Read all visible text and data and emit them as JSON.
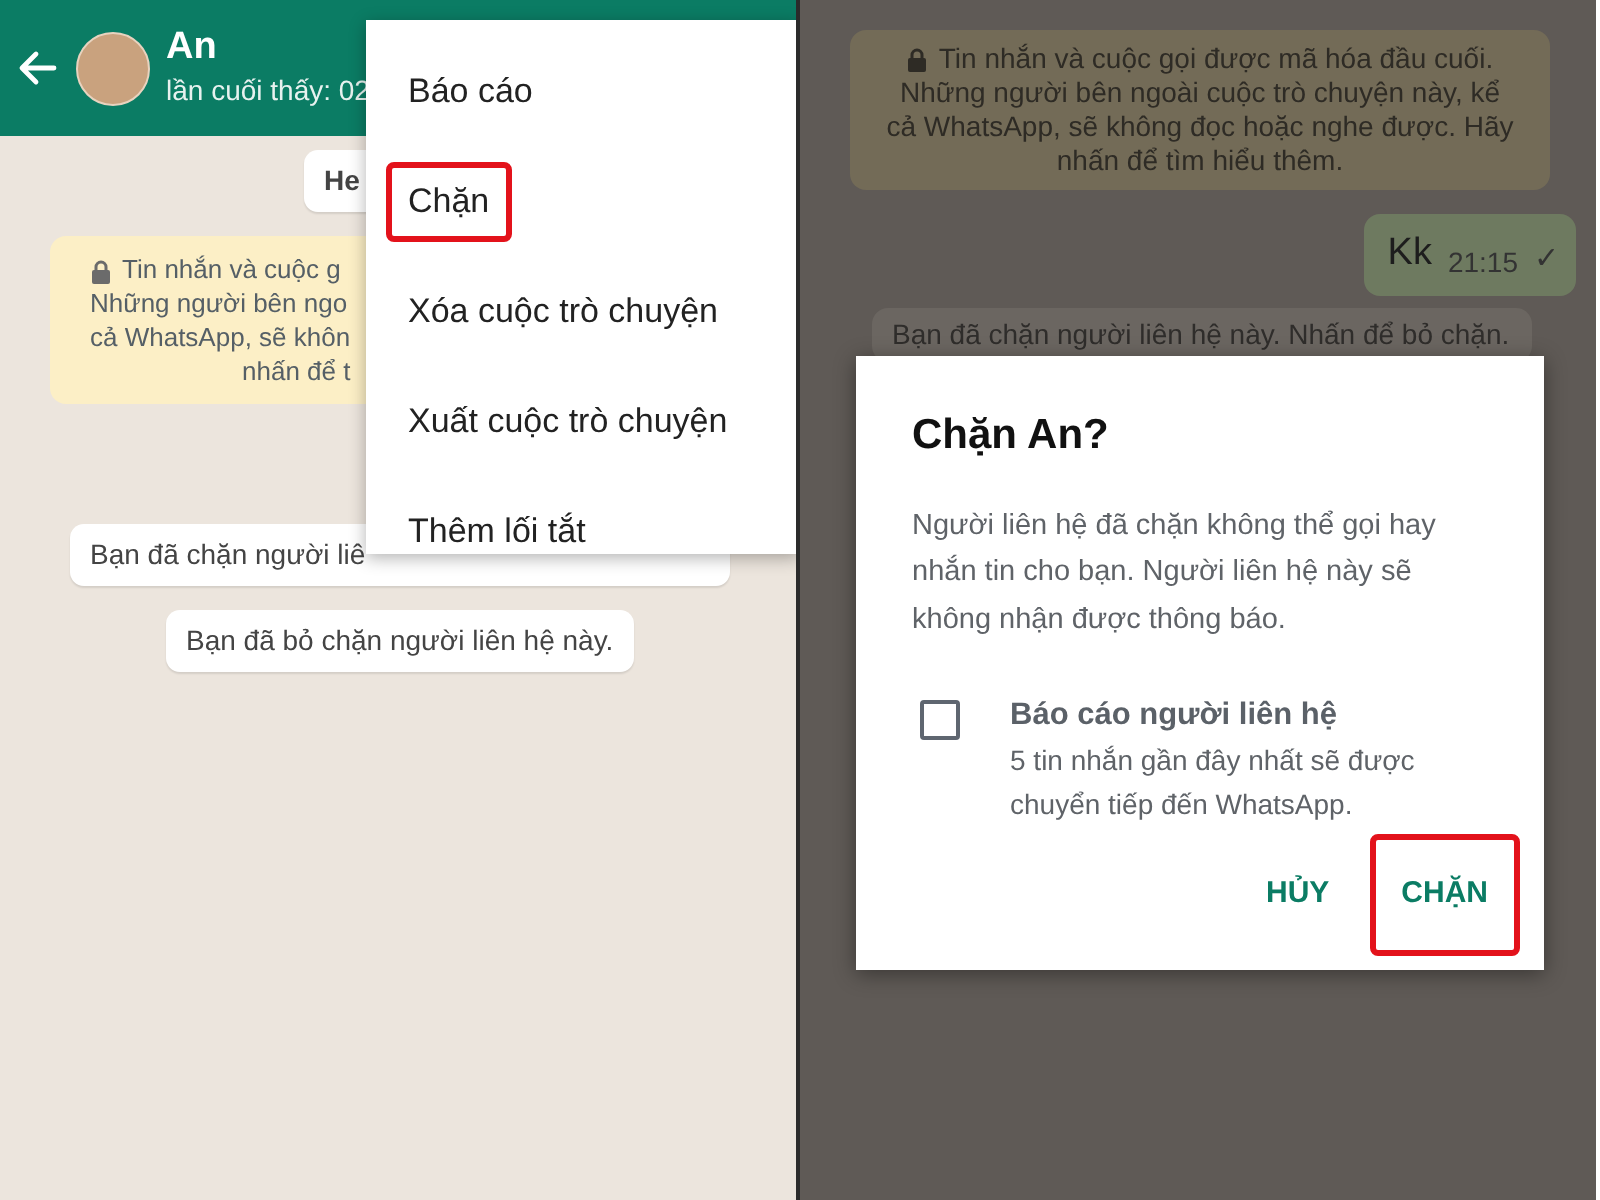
{
  "left_screen": {
    "header": {
      "contact_name": "An",
      "last_seen": "lần cuối thấy: 02"
    },
    "date_chip": "He",
    "encryption_notice": {
      "lines": [
        "Tin nhắn và cuộc g",
        "Những người bên ngo",
        "cả WhatsApp, sẽ khôn",
        "nhấn để t"
      ]
    },
    "system_messages": [
      "Bạn đã chặn người liê",
      "Bạn đã bỏ chặn người liên hệ này."
    ],
    "menu": [
      {
        "label": "Báo cáo",
        "highlighted": false
      },
      {
        "label": "Chặn",
        "highlighted": true
      },
      {
        "label": "Xóa cuộc trò chuyện",
        "highlighted": false
      },
      {
        "label": "Xuất cuộc trò chuyện",
        "highlighted": false
      },
      {
        "label": "Thêm lối tắt",
        "highlighted": false
      }
    ]
  },
  "right_screen": {
    "encryption_notice": {
      "lines": [
        "Tin nhắn và cuộc gọi được mã hóa đầu cuối.",
        "Những người bên ngoài cuộc trò chuyện này, kể",
        "cả WhatsApp, sẽ không đọc hoặc nghe được. Hãy",
        "nhấn để tìm hiểu thêm."
      ]
    },
    "messages": [
      {
        "text": "Kk",
        "time": "21:15",
        "tick": "✓"
      }
    ],
    "system_message": "Bạn đã chặn người liên hệ này. Nhấn để bỏ chặn.",
    "dialog": {
      "title": "Chặn An?",
      "body": "Người liên hệ đã chặn không thể gọi hay nhắn tin cho bạn. Người liên hệ này sẽ không nhận được thông báo.",
      "checkbox": {
        "label": "Báo cáo người liên hệ",
        "description": "5 tin nhắn gần đây nhất sẽ được chuyển tiếp đến WhatsApp.",
        "checked": false
      },
      "buttons": [
        {
          "label": "HỦY",
          "highlighted": false
        },
        {
          "label": "CHẶN",
          "highlighted": true
        }
      ]
    }
  }
}
